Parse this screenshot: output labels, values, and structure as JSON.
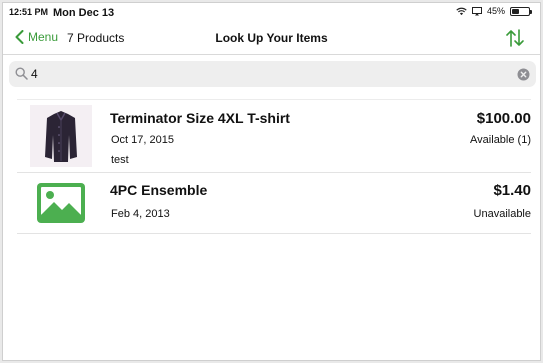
{
  "status_bar": {
    "time": "12:51 PM",
    "date": "Mon Dec 13",
    "battery": "45%",
    "battery_level": 0.45
  },
  "nav": {
    "back_label": "Menu",
    "product_count": "7 Products",
    "title": "Look Up Your Items",
    "accent_color": "#3a9b3a"
  },
  "search": {
    "value": "4",
    "placeholder": ""
  },
  "items": [
    {
      "name": "Terminator Size 4XL T-shirt",
      "date": "Oct 17, 2015",
      "note": "test",
      "price": "$100.00",
      "availability": "Available (1)",
      "image": "jacket-photo"
    },
    {
      "name": "4PC Ensemble",
      "date": "Feb 4, 2013",
      "price": "$1.40",
      "availability": "Unavailable",
      "image": "image-placeholder-icon"
    }
  ]
}
